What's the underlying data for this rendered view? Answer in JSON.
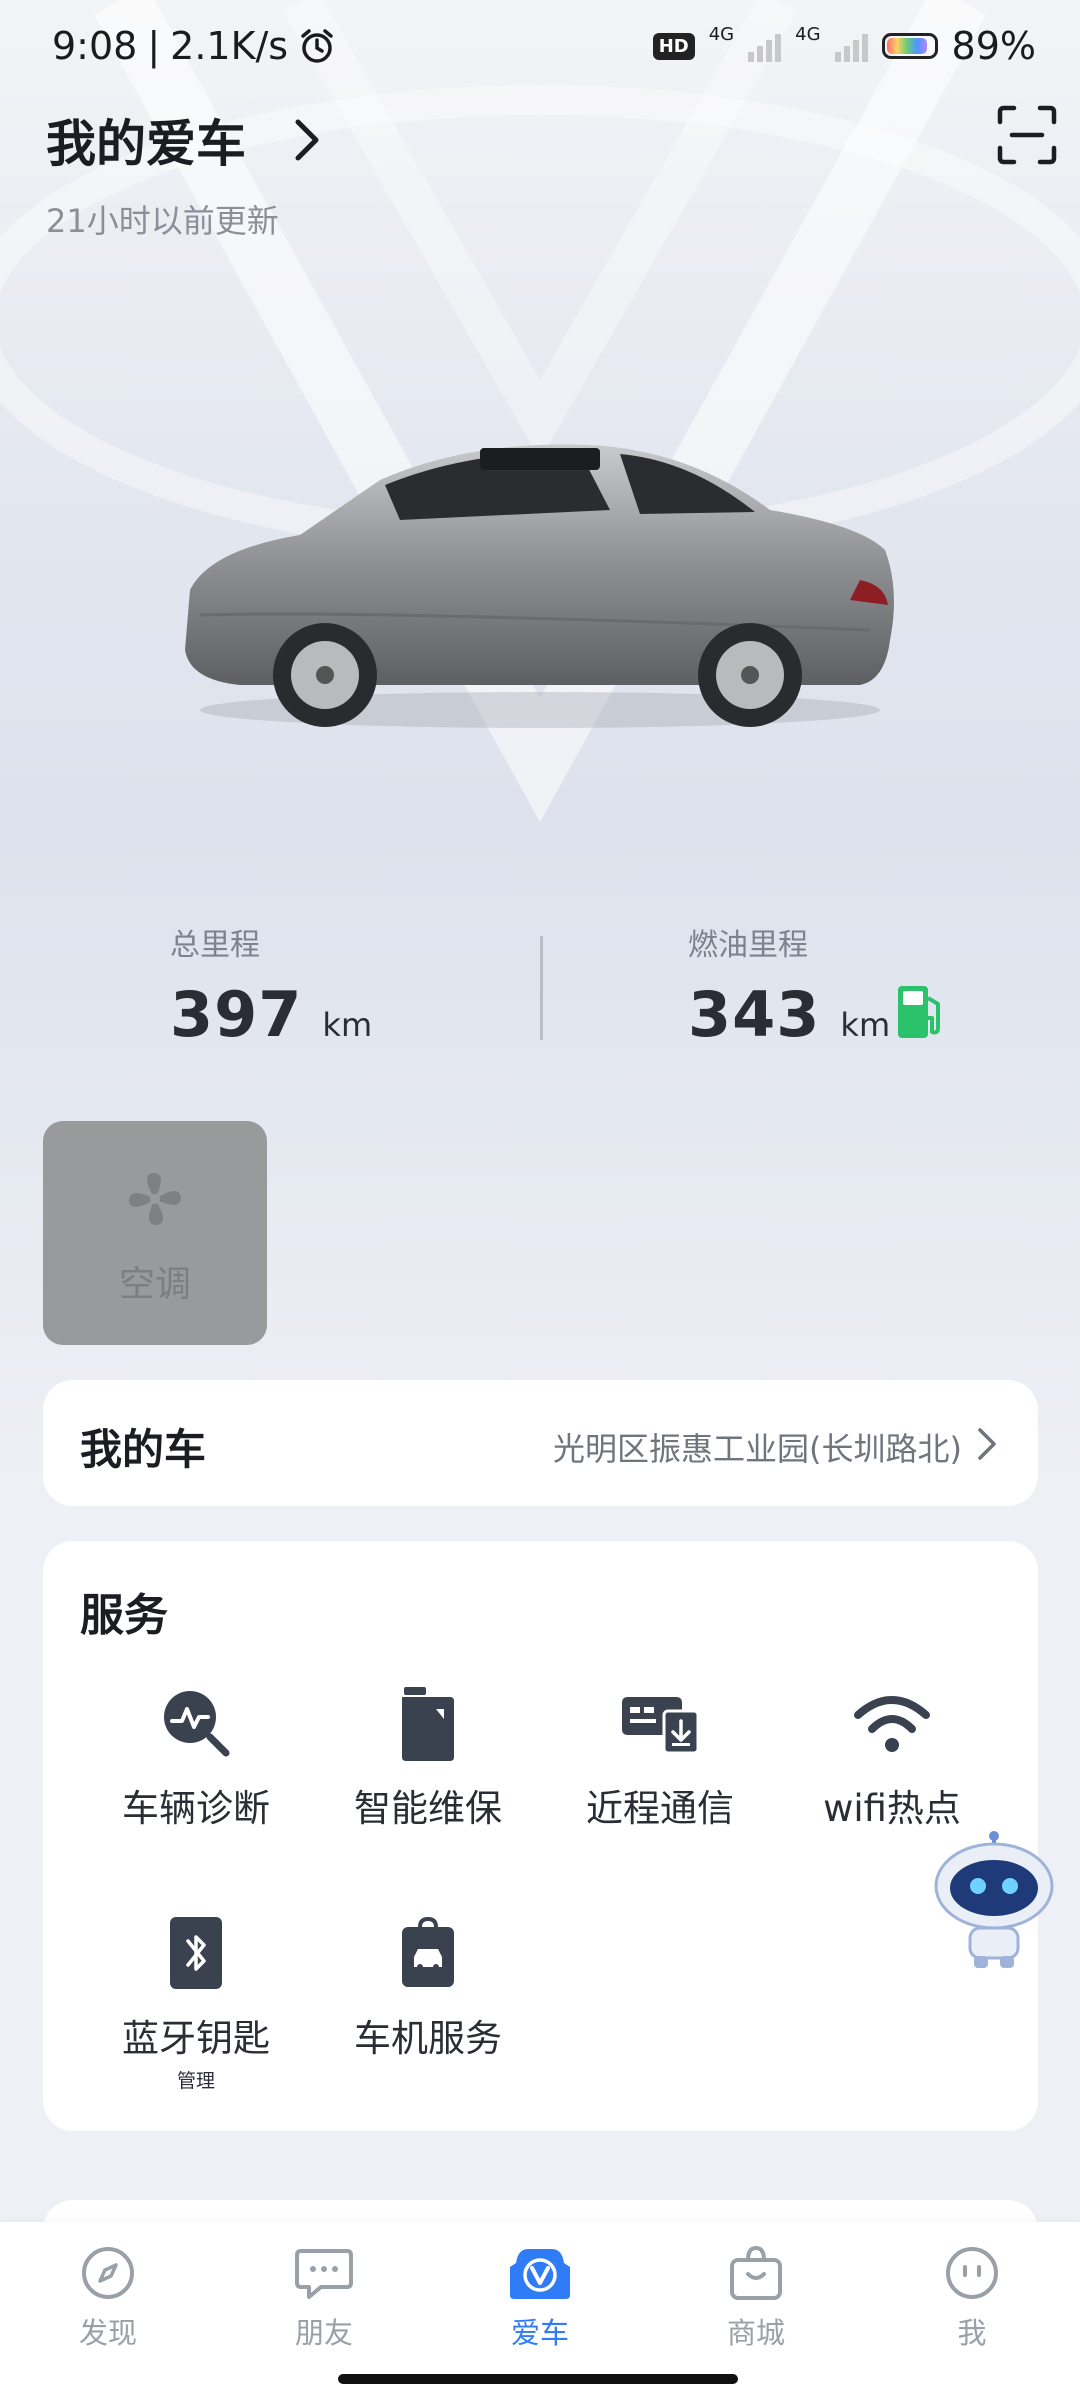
{
  "status_bar": {
    "time": "9:08",
    "speed": "2.1K/s",
    "hd_badge": "HD",
    "net1": "4G",
    "net2": "4G",
    "battery": "89%",
    "battery_level": 0.89
  },
  "header": {
    "title": "我的爱车",
    "updated": "21小时以前更新"
  },
  "stats": {
    "total_label": "总里程",
    "total_value": "397",
    "total_unit": "km",
    "fuel_label": "燃油里程",
    "fuel_value": "343",
    "fuel_unit": "km"
  },
  "ac_tile": {
    "label": "空调"
  },
  "my_car": {
    "title": "我的车",
    "location": "光明区振惠工业园(长圳路北)"
  },
  "services": {
    "title": "服务",
    "items": [
      {
        "label": "车辆诊断",
        "icon": "diagnosis-icon"
      },
      {
        "label": "智能维保",
        "icon": "maintenance-icon"
      },
      {
        "label": "近程通信",
        "icon": "near-field-comm-icon"
      },
      {
        "label": "wifi热点",
        "icon": "wifi-icon"
      },
      {
        "label": "蓝牙钥匙",
        "sub": "管理",
        "icon": "bluetooth-key-icon"
      },
      {
        "label": "车机服务",
        "icon": "car-service-icon"
      }
    ]
  },
  "tabbar": {
    "items": [
      {
        "label": "发现",
        "icon": "compass-icon"
      },
      {
        "label": "朋友",
        "icon": "chat-icon"
      },
      {
        "label": "爱车",
        "icon": "car-v-icon",
        "active": true
      },
      {
        "label": "商城",
        "icon": "bag-icon"
      },
      {
        "label": "我",
        "icon": "face-icon"
      }
    ]
  },
  "colors": {
    "accent": "#2f7cf6",
    "fuel_green": "#2bc26b",
    "icon_dark": "#3a4250"
  }
}
